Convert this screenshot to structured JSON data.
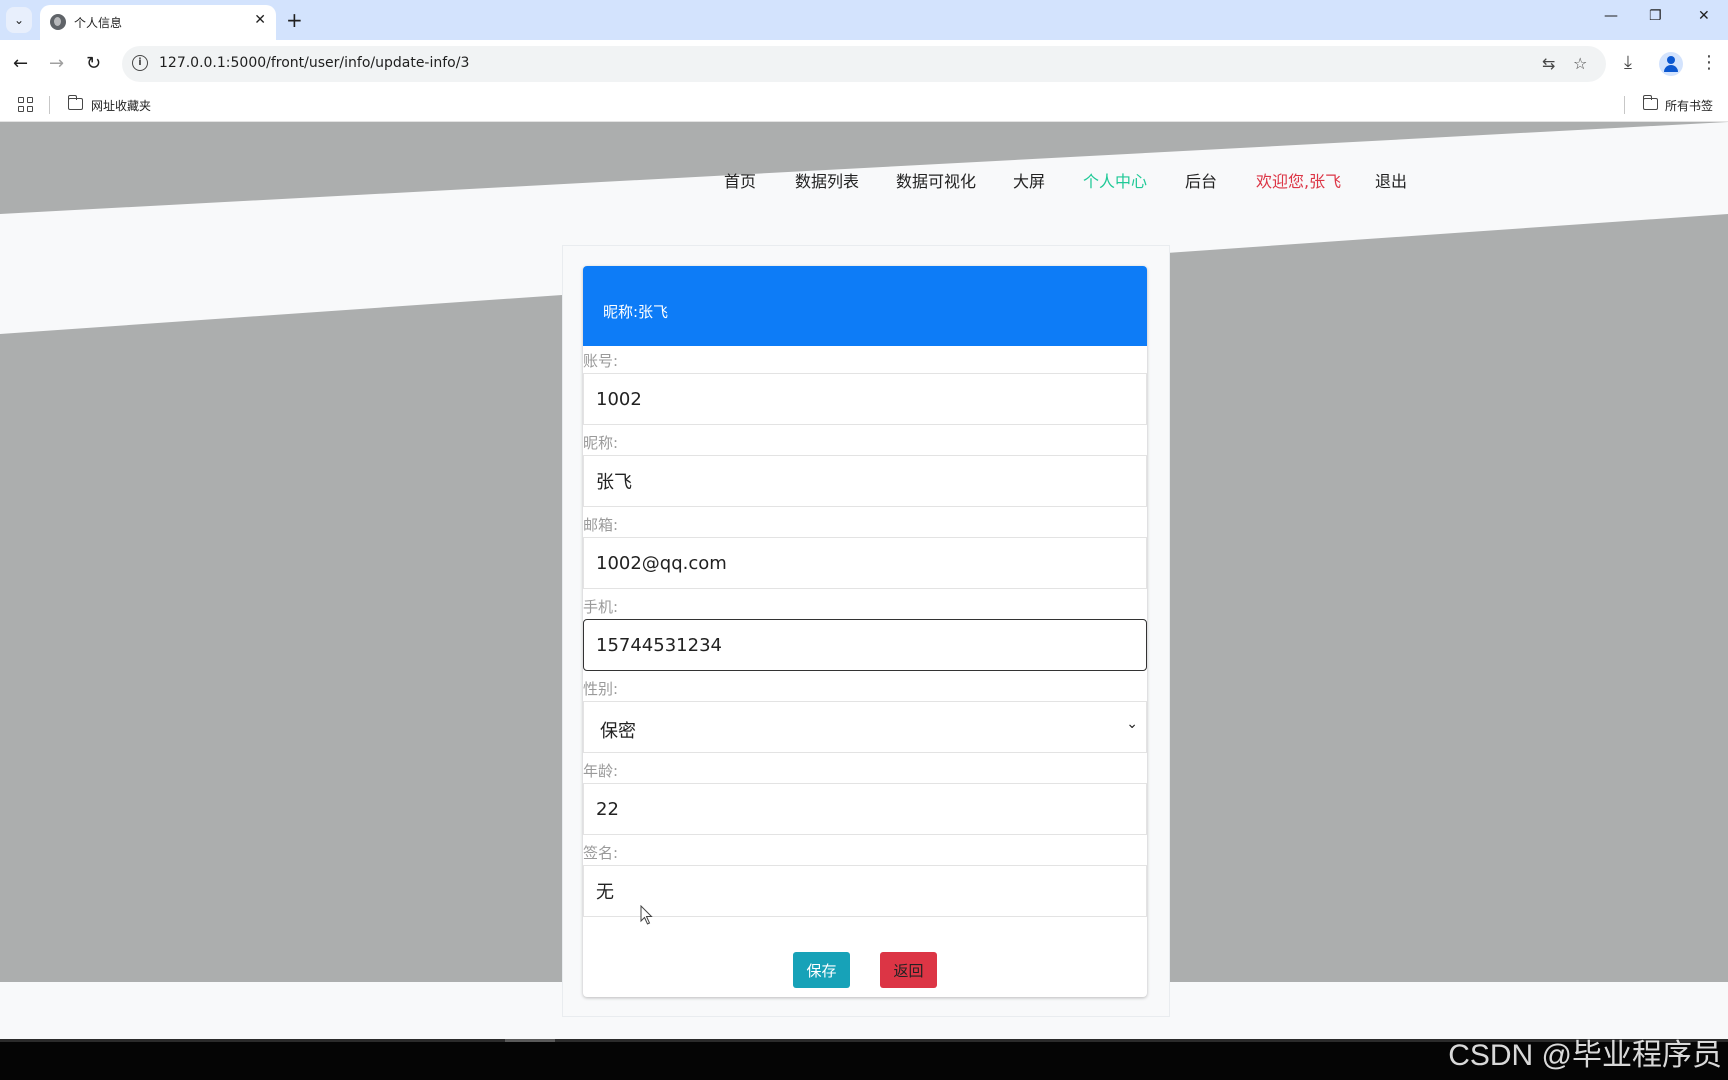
{
  "browser": {
    "tab_title": "个人信息",
    "tab_close": "✕",
    "new_tab": "+",
    "menu_glyph": "⌄",
    "url": "127.0.0.1:5000/front/user/info/update-info/3",
    "back": "←",
    "forward": "→",
    "reload": "↻",
    "translate_glyph": "⇆",
    "star_glyph": "☆",
    "download_glyph": "⤓",
    "more_glyph": "⋮",
    "minimize": "—",
    "restore": "❐",
    "close": "✕",
    "bookmarks": {
      "favorites_folder": "网址收藏夹",
      "all_bookmarks": "所有书签"
    }
  },
  "nav": {
    "items": [
      {
        "label": "首页"
      },
      {
        "label": "数据列表"
      },
      {
        "label": "数据可视化"
      },
      {
        "label": "大屏"
      },
      {
        "label": "个人中心"
      },
      {
        "label": "后台"
      },
      {
        "label": "欢迎您,张飞"
      },
      {
        "label": "退出"
      }
    ],
    "active_color": "#20c997",
    "welcome_color": "#dc3545"
  },
  "profile": {
    "header": "昵称:张飞",
    "fields": {
      "account": {
        "label": "账号:",
        "value": "1002"
      },
      "nickname": {
        "label": "昵称:",
        "value": "张飞"
      },
      "email": {
        "label": "邮箱:",
        "value": "1002@qq.com"
      },
      "phone": {
        "label": "手机:",
        "value": "15744531234"
      },
      "gender": {
        "label": "性别:",
        "value": "保密"
      },
      "age": {
        "label": "年龄:",
        "value": "22"
      },
      "signature": {
        "label": "签名:",
        "value": "无"
      }
    },
    "save_label": "保存",
    "back_label": "返回",
    "header_color": "#0d7cf7",
    "save_color": "#17a2b8",
    "back_color": "#dc3545"
  },
  "watermark": "CSDN @毕业程序员"
}
